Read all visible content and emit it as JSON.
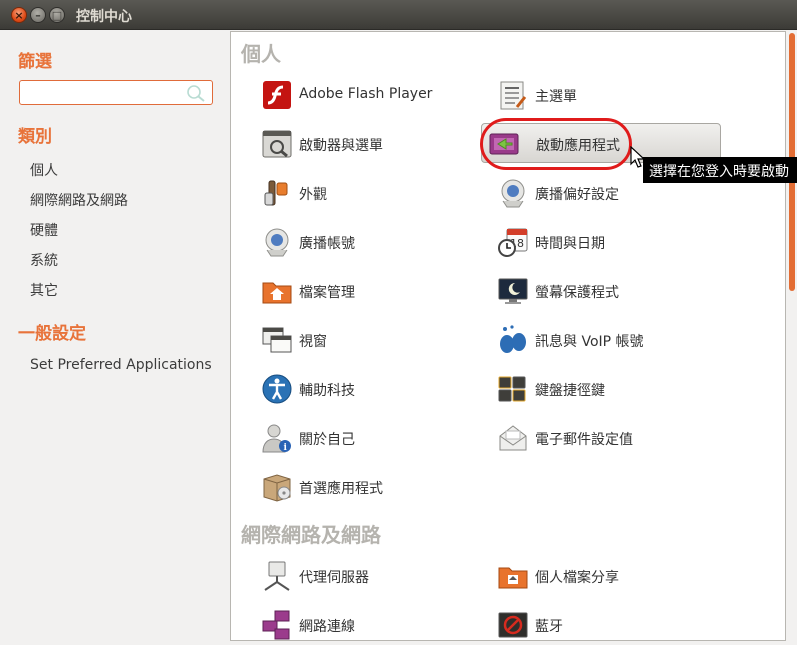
{
  "window": {
    "title": "控制中心"
  },
  "sidebar": {
    "filter_heading": "篩選",
    "filter_value": "",
    "category_heading": "類別",
    "categories": [
      "個人",
      "網際網路及網路",
      "硬體",
      "系統",
      "其它"
    ],
    "general_heading": "一般設定",
    "general_items": [
      "Set Preferred Applications"
    ]
  },
  "main": {
    "sections": [
      {
        "title": "個人",
        "items": [
          {
            "label": "Adobe Flash Player",
            "icon": "flash-icon"
          },
          {
            "label": "主選單",
            "icon": "main-menu-icon"
          },
          {
            "label": "啟動器與選單",
            "icon": "launcher-icon"
          },
          {
            "label": "啟動應用程式",
            "icon": "startup-apps-icon"
          },
          {
            "label": "外觀",
            "icon": "appearance-icon"
          },
          {
            "label": "廣播偏好設定",
            "icon": "broadcast-prefs-icon"
          },
          {
            "label": "廣播帳號",
            "icon": "broadcast-accounts-icon"
          },
          {
            "label": "時間與日期",
            "icon": "time-date-icon"
          },
          {
            "label": "檔案管理",
            "icon": "file-manager-icon"
          },
          {
            "label": "螢幕保護程式",
            "icon": "screensaver-icon"
          },
          {
            "label": "視窗",
            "icon": "windows-icon"
          },
          {
            "label": "訊息與 VoIP 帳號",
            "icon": "messaging-voip-icon"
          },
          {
            "label": "輔助科技",
            "icon": "accessibility-icon"
          },
          {
            "label": "鍵盤捷徑鍵",
            "icon": "keyboard-shortcuts-icon"
          },
          {
            "label": "關於自己",
            "icon": "about-me-icon"
          },
          {
            "label": "電子郵件設定值",
            "icon": "email-settings-icon"
          },
          {
            "label": "首選應用程式",
            "icon": "preferred-apps-icon"
          }
        ]
      },
      {
        "title": "網際網路及網路",
        "items": [
          {
            "label": "代理伺服器",
            "icon": "proxy-icon"
          },
          {
            "label": "個人檔案分享",
            "icon": "file-sharing-icon"
          },
          {
            "label": "網路連線",
            "icon": "network-connections-icon"
          },
          {
            "label": "藍牙",
            "icon": "bluetooth-icon"
          }
        ]
      }
    ]
  },
  "tooltip": "選擇在您登入時要啟動"
}
